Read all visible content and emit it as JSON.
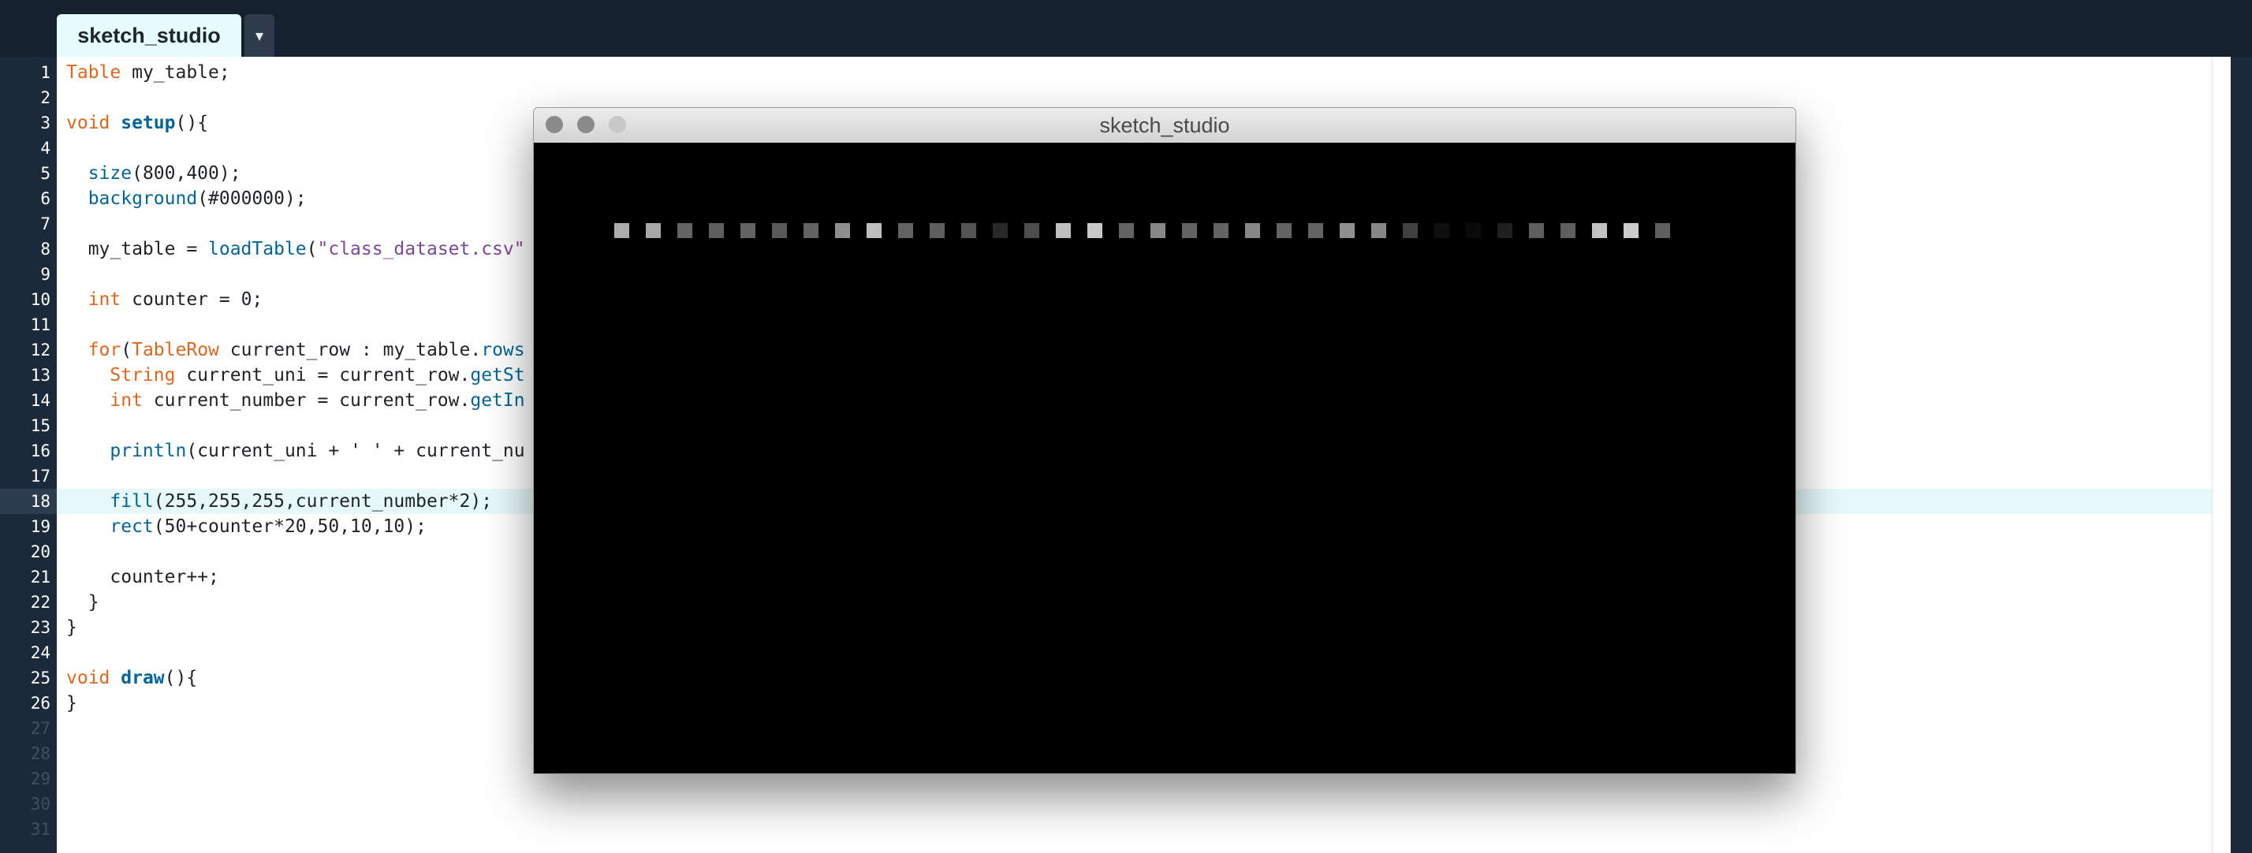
{
  "tab": {
    "name": "sketch_studio",
    "menu_glyph": "▾"
  },
  "editor": {
    "line_numbers": [
      "1",
      "2",
      "3",
      "4",
      "5",
      "6",
      "7",
      "8",
      "9",
      "10",
      "11",
      "12",
      "13",
      "14",
      "15",
      "16",
      "17",
      "18",
      "19",
      "20",
      "21",
      "22",
      "23",
      "24",
      "25",
      "26",
      "27",
      "28",
      "29",
      "30",
      "31"
    ],
    "highlighted_line": 18
  },
  "code": {
    "l1": {
      "a": "Table",
      "b": " my_table;"
    },
    "l3": {
      "a": "void ",
      "b": "setup",
      "c": "(){"
    },
    "l5": {
      "a": "  ",
      "b": "size",
      "c": "(800,400);"
    },
    "l6": {
      "a": "  ",
      "b": "background",
      "c": "(#000000);"
    },
    "l8": {
      "a": "  my_table = ",
      "b": "loadTable",
      "c": "(",
      "d": "\"class_dataset.csv\""
    },
    "l10": {
      "a": "  ",
      "b": "int",
      "c": " counter = 0;"
    },
    "l12": {
      "a": "  ",
      "b": "for",
      "c": "(",
      "d": "TableRow",
      "e": " current_row : my_table.",
      "f": "rows"
    },
    "l13": {
      "a": "    ",
      "b": "String",
      "c": " current_uni = current_row.",
      "d": "getSt"
    },
    "l14": {
      "a": "    ",
      "b": "int",
      "c": " current_number = current_row.",
      "d": "getIn"
    },
    "l16": {
      "a": "    ",
      "b": "println",
      "c": "(current_uni + ' ' + current_nu"
    },
    "l18": {
      "a": "    ",
      "b": "fill",
      "c": "(255,255,255,current_number*2);"
    },
    "l19": {
      "a": "    ",
      "b": "rect",
      "c": "(50+counter*20,50,10,10);"
    },
    "l21": {
      "a": "    counter++;"
    },
    "l22": {
      "a": "  }"
    },
    "l23": {
      "a": "}"
    },
    "l25": {
      "a": "void ",
      "b": "draw",
      "c": "(){"
    },
    "l26": {
      "a": "}"
    }
  },
  "sketch_window": {
    "title": "sketch_studio",
    "canvas_background": "#000000",
    "rect_brightness": [
      0.68,
      0.66,
      0.39,
      0.37,
      0.39,
      0.35,
      0.39,
      0.56,
      0.75,
      0.39,
      0.37,
      0.33,
      0.16,
      0.3,
      0.75,
      0.78,
      0.39,
      0.53,
      0.39,
      0.39,
      0.53,
      0.39,
      0.39,
      0.56,
      0.53,
      0.25,
      0.06,
      0.04,
      0.12,
      0.37,
      0.37,
      0.76,
      0.8,
      0.37
    ]
  },
  "colors": {
    "keyword": "#e2661a",
    "function": "#006699",
    "string": "#7d4698",
    "highlight_row": "#e6f8f8"
  }
}
